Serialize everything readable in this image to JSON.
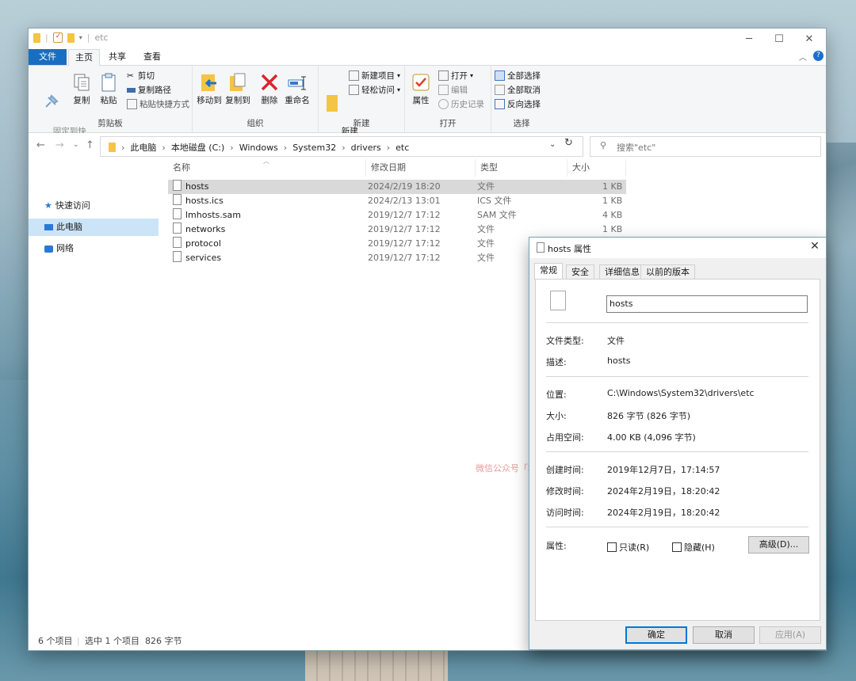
{
  "window": {
    "title": "etc"
  },
  "ribbon_tabs": [
    "文件",
    "主页",
    "共享",
    "查看"
  ],
  "ribbon": {
    "clipboard": {
      "group": "剪贴板",
      "pin": "固定到快\n速访问",
      "copy": "复制",
      "paste": "粘贴",
      "cut": "剪切",
      "copy_path": "复制路径",
      "paste_shortcut": "粘贴快捷方式"
    },
    "organize": {
      "group": "组织",
      "move_to": "移动到",
      "copy_to": "复制到",
      "delete": "删除",
      "rename": "重命名"
    },
    "new": {
      "group": "新建",
      "new_folder": "新建\n文件夹",
      "new_item": "新建项目",
      "easy_access": "轻松访问"
    },
    "open": {
      "group": "打开",
      "properties": "属性",
      "open": "打开",
      "edit": "编辑",
      "history": "历史记录"
    },
    "select": {
      "group": "选择",
      "select_all": "全部选择",
      "select_none": "全部取消",
      "invert": "反向选择"
    }
  },
  "address": {
    "crumbs": [
      "此电脑",
      "本地磁盘 (C:)",
      "Windows",
      "System32",
      "drivers",
      "etc"
    ],
    "search_placeholder": "搜索\"etc\""
  },
  "nav": {
    "quick_access": "快速访问",
    "this_pc": "此电脑",
    "network": "网络"
  },
  "columns": {
    "name": "名称",
    "modified": "修改日期",
    "type": "类型",
    "size": "大小"
  },
  "files": [
    {
      "name": "hosts",
      "modified": "2024/2/19 18:20",
      "type": "文件",
      "size": "1 KB"
    },
    {
      "name": "hosts.ics",
      "modified": "2024/2/13 13:01",
      "type": "ICS 文件",
      "size": "1 KB"
    },
    {
      "name": "lmhosts.sam",
      "modified": "2019/12/7 17:12",
      "type": "SAM 文件",
      "size": "4 KB"
    },
    {
      "name": "networks",
      "modified": "2019/12/7 17:12",
      "type": "文件",
      "size": "1 KB"
    },
    {
      "name": "protocol",
      "modified": "2019/12/7 17:12",
      "type": "文件",
      "size": ""
    },
    {
      "name": "services",
      "modified": "2019/12/7 17:12",
      "type": "文件",
      "size": ""
    }
  ],
  "watermark": "微信公众号「科技BOOM」",
  "status": {
    "count": "6 个项目",
    "selection": "选中 1 个项目  826 字节"
  },
  "dialog": {
    "title": "hosts 属性",
    "tabs": [
      "常规",
      "安全",
      "详细信息",
      "以前的版本"
    ],
    "filename": "hosts",
    "labels": {
      "file_type": "文件类型:",
      "description": "描述:",
      "location": "位置:",
      "size": "大小:",
      "size_on_disk": "占用空间:",
      "created": "创建时间:",
      "modified": "修改时间:",
      "accessed": "访问时间:",
      "attributes": "属性:"
    },
    "values": {
      "file_type": "文件",
      "description": "hosts",
      "location": "C:\\Windows\\System32\\drivers\\etc",
      "size": "826 字节 (826 字节)",
      "size_on_disk": "4.00 KB (4,096 字节)",
      "created": "2019年12月7日，17:14:57",
      "modified": "2024年2月19日，18:20:42",
      "accessed": "2024年2月19日，18:20:42"
    },
    "readonly": "只读(R)",
    "hidden": "隐藏(H)",
    "advanced": "高级(D)...",
    "ok": "确定",
    "cancel": "取消",
    "apply": "应用(A)"
  }
}
